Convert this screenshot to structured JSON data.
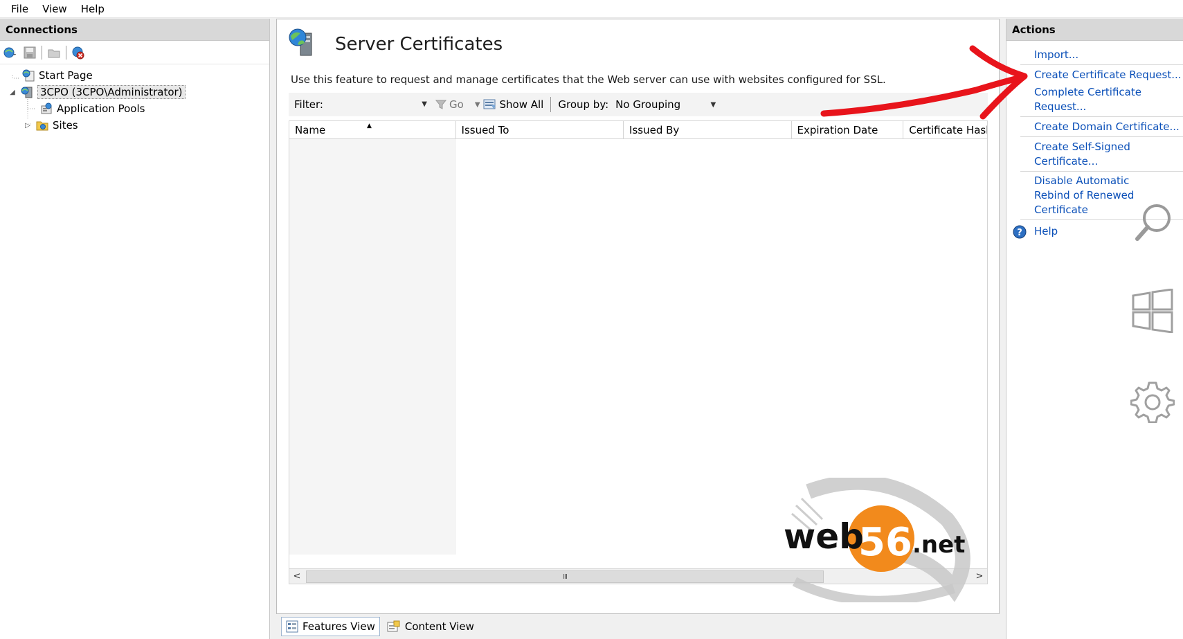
{
  "menu": {
    "items": [
      "File",
      "View",
      "Help"
    ]
  },
  "connections": {
    "header": "Connections",
    "tree": [
      {
        "label": "Start Page",
        "icon": "start-page-icon",
        "level": 0,
        "expander": ""
      },
      {
        "label": "3CPO (3CPO\\Administrator)",
        "icon": "server-icon",
        "level": 0,
        "expander": "◢",
        "selected": true
      },
      {
        "label": "Application Pools",
        "icon": "app-pools-icon",
        "level": 1,
        "expander": ""
      },
      {
        "label": "Sites",
        "icon": "sites-folder-icon",
        "level": 1,
        "expander": "▷"
      }
    ]
  },
  "center": {
    "title": "Server Certificates",
    "description": "Use this feature to request and manage certificates that the Web server can use with websites configured for SSL.",
    "filter": {
      "label": "Filter:",
      "value": "",
      "go_label": "Go",
      "show_all_label": "Show All",
      "group_by_label": "Group by:",
      "group_by_value": "No Grouping"
    },
    "columns": [
      "Name",
      "Issued To",
      "Issued By",
      "Expiration Date",
      "Certificate Hash"
    ],
    "rows": [],
    "scroll_grip": "III"
  },
  "view_tabs": {
    "features": "Features View",
    "content": "Content View",
    "active": "features"
  },
  "actions": {
    "header": "Actions",
    "items": [
      "Import...",
      "Create Certificate Request...",
      "Complete Certificate Request...",
      "Create Domain Certificate...",
      "Create Self-Signed Certificate...",
      "Disable Automatic Rebind of Renewed Certificate",
      "Help"
    ]
  },
  "watermark": {
    "text_main": "web",
    "text_num": "56",
    "text_tld": ".net"
  },
  "colors": {
    "link": "#0a4fb8",
    "annotation": "#e8141b",
    "watermark_orange": "#f28a1c",
    "header_gray": "#d8d8d8"
  }
}
